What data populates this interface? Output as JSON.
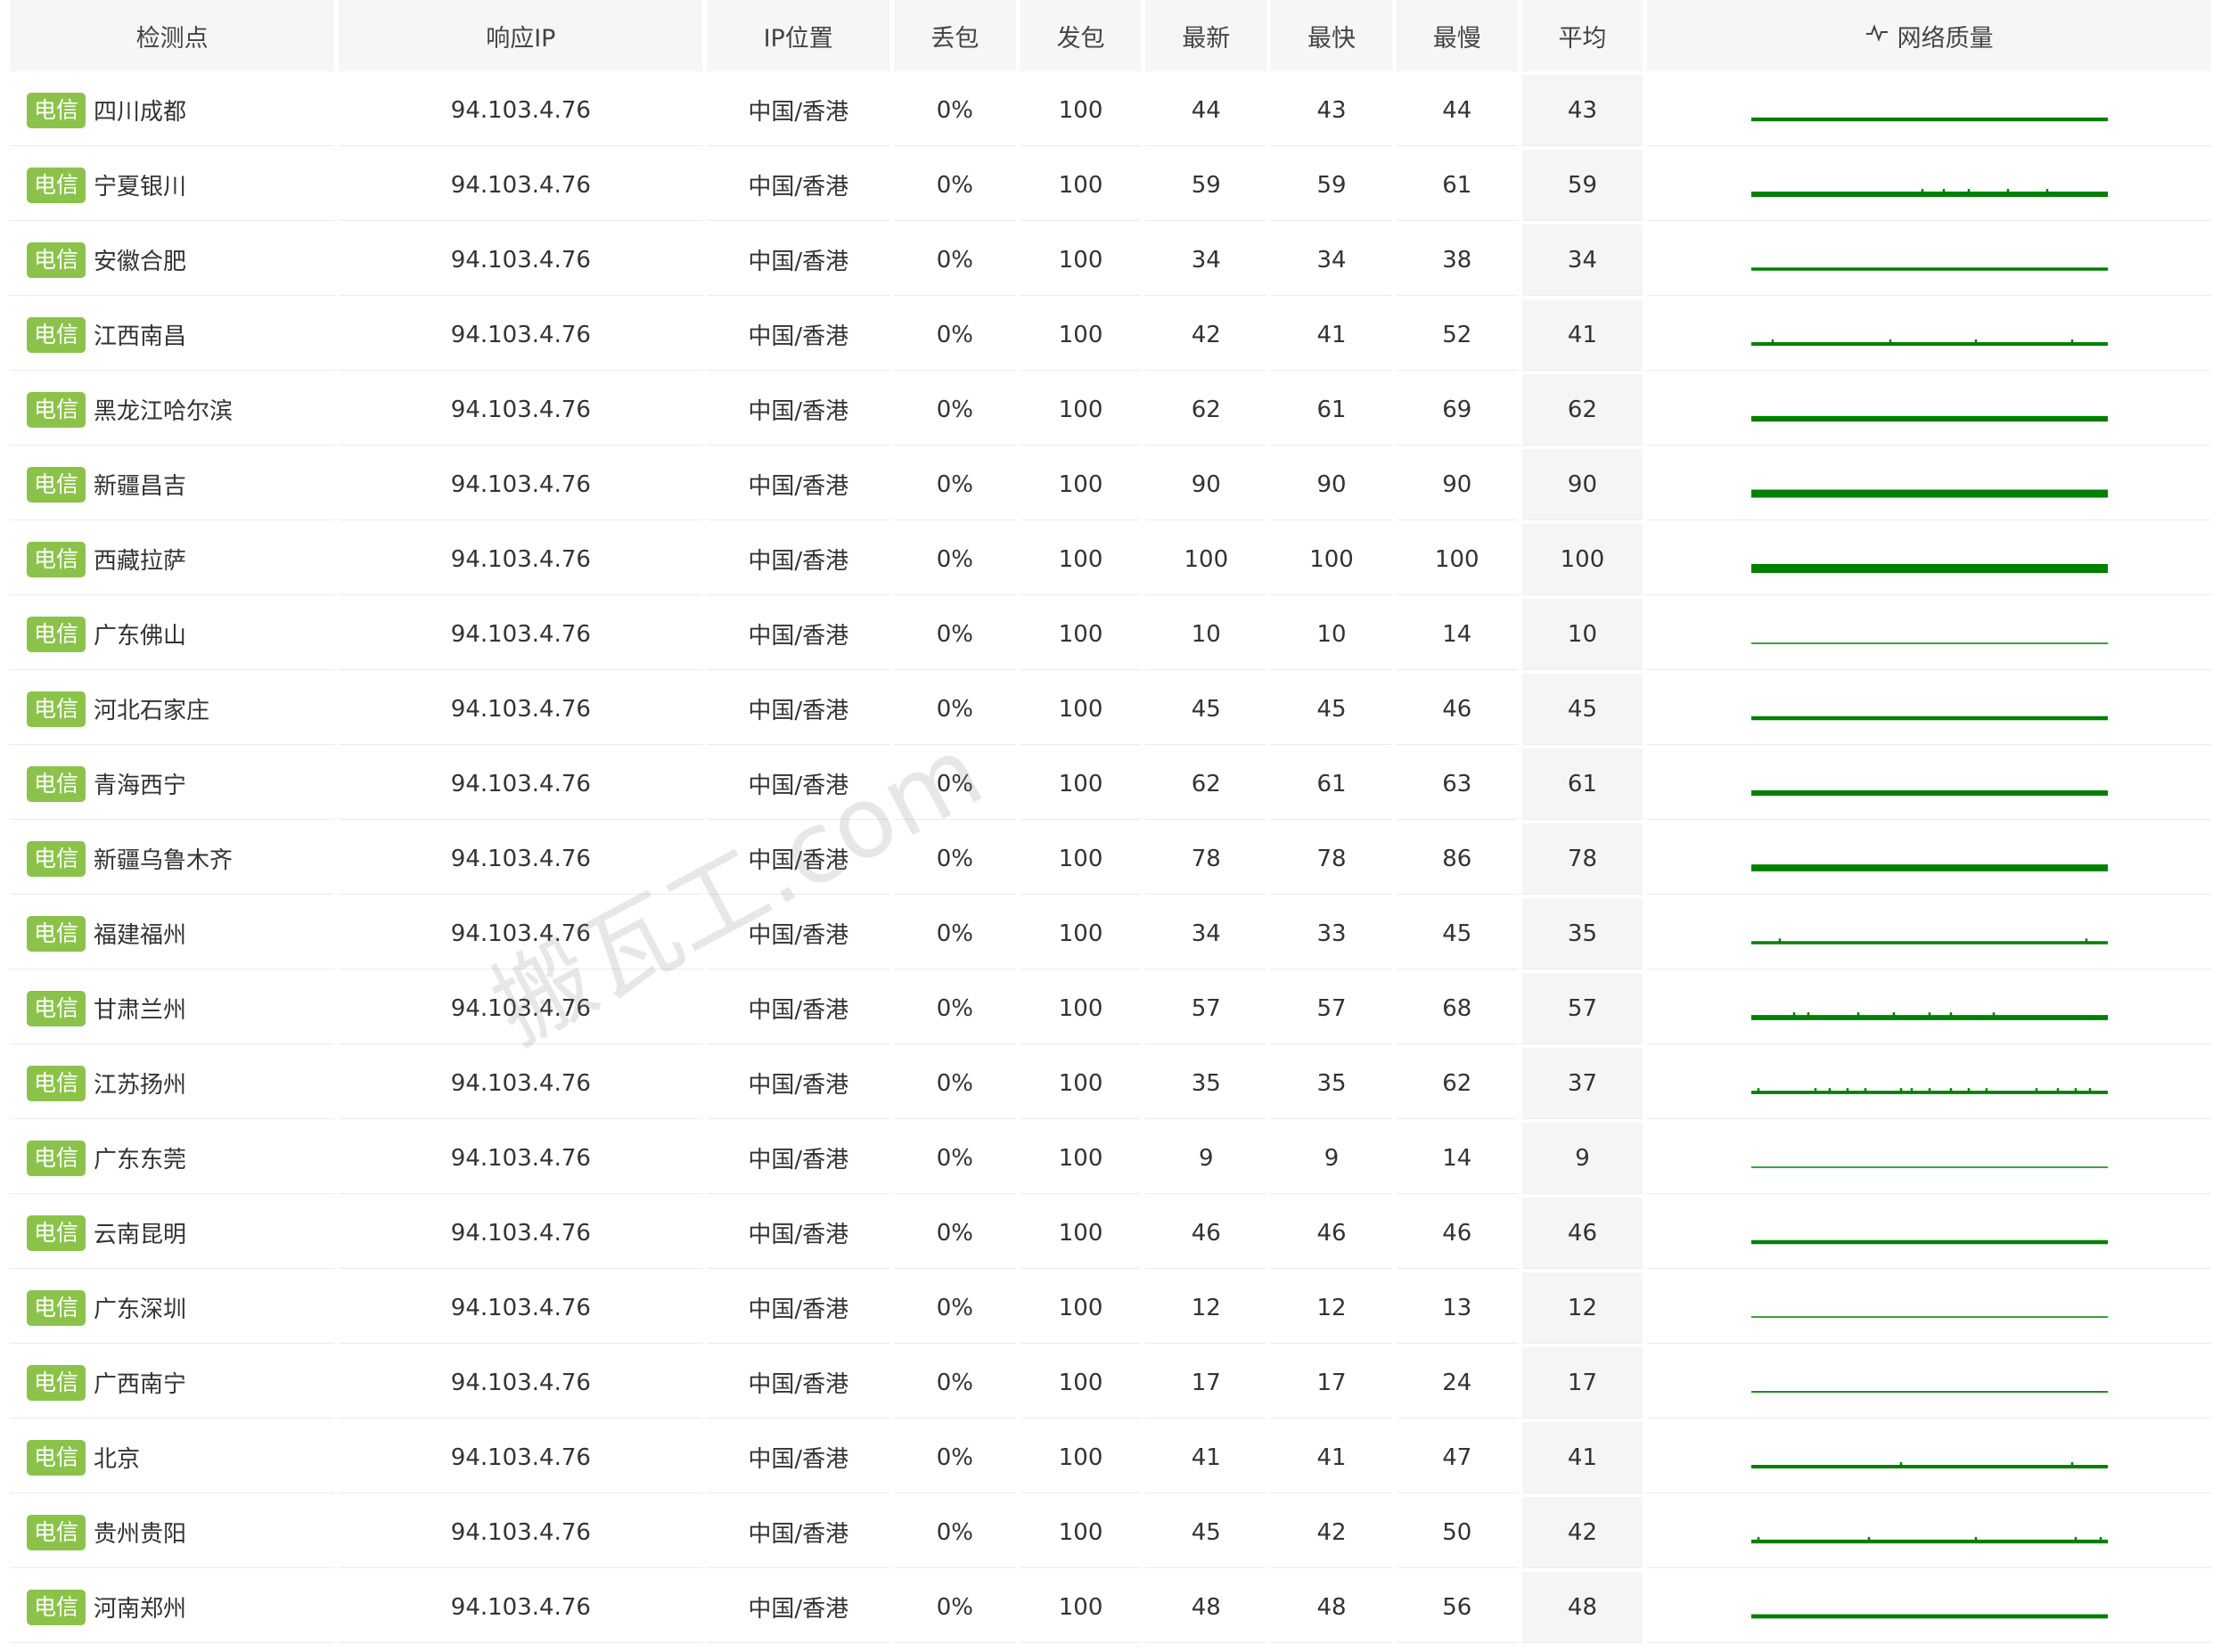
{
  "header": {
    "point": "检测点",
    "ip": "响应IP",
    "location": "IP位置",
    "loss": "丢包",
    "sent": "发包",
    "latest": "最新",
    "fastest": "最快",
    "slowest": "最慢",
    "average": "平均",
    "quality": "网络质量",
    "quality_icon": "pulse-icon"
  },
  "rows": [
    {
      "isp": "电信",
      "point": "四川成都",
      "ip": "94.103.4.76",
      "location": "中国/香港",
      "loss": "0%",
      "sent": "100",
      "latest": "44",
      "fastest": "43",
      "slowest": "44",
      "average": "43"
    },
    {
      "isp": "电信",
      "point": "宁夏银川",
      "ip": "94.103.4.76",
      "location": "中国/香港",
      "loss": "0%",
      "sent": "100",
      "latest": "59",
      "fastest": "59",
      "slowest": "61",
      "average": "59"
    },
    {
      "isp": "电信",
      "point": "安徽合肥",
      "ip": "94.103.4.76",
      "location": "中国/香港",
      "loss": "0%",
      "sent": "100",
      "latest": "34",
      "fastest": "34",
      "slowest": "38",
      "average": "34"
    },
    {
      "isp": "电信",
      "point": "江西南昌",
      "ip": "94.103.4.76",
      "location": "中国/香港",
      "loss": "0%",
      "sent": "100",
      "latest": "42",
      "fastest": "41",
      "slowest": "52",
      "average": "41"
    },
    {
      "isp": "电信",
      "point": "黑龙江哈尔滨",
      "ip": "94.103.4.76",
      "location": "中国/香港",
      "loss": "0%",
      "sent": "100",
      "latest": "62",
      "fastest": "61",
      "slowest": "69",
      "average": "62"
    },
    {
      "isp": "电信",
      "point": "新疆昌吉",
      "ip": "94.103.4.76",
      "location": "中国/香港",
      "loss": "0%",
      "sent": "100",
      "latest": "90",
      "fastest": "90",
      "slowest": "90",
      "average": "90"
    },
    {
      "isp": "电信",
      "point": "西藏拉萨",
      "ip": "94.103.4.76",
      "location": "中国/香港",
      "loss": "0%",
      "sent": "100",
      "latest": "100",
      "fastest": "100",
      "slowest": "100",
      "average": "100"
    },
    {
      "isp": "电信",
      "point": "广东佛山",
      "ip": "94.103.4.76",
      "location": "中国/香港",
      "loss": "0%",
      "sent": "100",
      "latest": "10",
      "fastest": "10",
      "slowest": "14",
      "average": "10"
    },
    {
      "isp": "电信",
      "point": "河北石家庄",
      "ip": "94.103.4.76",
      "location": "中国/香港",
      "loss": "0%",
      "sent": "100",
      "latest": "45",
      "fastest": "45",
      "slowest": "46",
      "average": "45"
    },
    {
      "isp": "电信",
      "point": "青海西宁",
      "ip": "94.103.4.76",
      "location": "中国/香港",
      "loss": "0%",
      "sent": "100",
      "latest": "62",
      "fastest": "61",
      "slowest": "63",
      "average": "61"
    },
    {
      "isp": "电信",
      "point": "新疆乌鲁木齐",
      "ip": "94.103.4.76",
      "location": "中国/香港",
      "loss": "0%",
      "sent": "100",
      "latest": "78",
      "fastest": "78",
      "slowest": "86",
      "average": "78"
    },
    {
      "isp": "电信",
      "point": "福建福州",
      "ip": "94.103.4.76",
      "location": "中国/香港",
      "loss": "0%",
      "sent": "100",
      "latest": "34",
      "fastest": "33",
      "slowest": "45",
      "average": "35"
    },
    {
      "isp": "电信",
      "point": "甘肃兰州",
      "ip": "94.103.4.76",
      "location": "中国/香港",
      "loss": "0%",
      "sent": "100",
      "latest": "57",
      "fastest": "57",
      "slowest": "68",
      "average": "57"
    },
    {
      "isp": "电信",
      "point": "江苏扬州",
      "ip": "94.103.4.76",
      "location": "中国/香港",
      "loss": "0%",
      "sent": "100",
      "latest": "35",
      "fastest": "35",
      "slowest": "62",
      "average": "37"
    },
    {
      "isp": "电信",
      "point": "广东东莞",
      "ip": "94.103.4.76",
      "location": "中国/香港",
      "loss": "0%",
      "sent": "100",
      "latest": "9",
      "fastest": "9",
      "slowest": "14",
      "average": "9"
    },
    {
      "isp": "电信",
      "point": "云南昆明",
      "ip": "94.103.4.76",
      "location": "中国/香港",
      "loss": "0%",
      "sent": "100",
      "latest": "46",
      "fastest": "46",
      "slowest": "46",
      "average": "46"
    },
    {
      "isp": "电信",
      "point": "广东深圳",
      "ip": "94.103.4.76",
      "location": "中国/香港",
      "loss": "0%",
      "sent": "100",
      "latest": "12",
      "fastest": "12",
      "slowest": "13",
      "average": "12"
    },
    {
      "isp": "电信",
      "point": "广西南宁",
      "ip": "94.103.4.76",
      "location": "中国/香港",
      "loss": "0%",
      "sent": "100",
      "latest": "17",
      "fastest": "17",
      "slowest": "24",
      "average": "17"
    },
    {
      "isp": "电信",
      "point": "北京",
      "ip": "94.103.4.76",
      "location": "中国/香港",
      "loss": "0%",
      "sent": "100",
      "latest": "41",
      "fastest": "41",
      "slowest": "47",
      "average": "41"
    },
    {
      "isp": "电信",
      "point": "贵州贵阳",
      "ip": "94.103.4.76",
      "location": "中国/香港",
      "loss": "0%",
      "sent": "100",
      "latest": "45",
      "fastest": "42",
      "slowest": "50",
      "average": "42"
    },
    {
      "isp": "电信",
      "point": "河南郑州",
      "ip": "94.103.4.76",
      "location": "中国/香港",
      "loss": "0%",
      "sent": "100",
      "latest": "48",
      "fastest": "48",
      "slowest": "56",
      "average": "48"
    }
  ],
  "colors": {
    "isp_tag": "#8bc34a",
    "sparkline": "#008000",
    "header_bg": "#f6f6f6"
  },
  "watermark": "搬瓦工.com"
}
